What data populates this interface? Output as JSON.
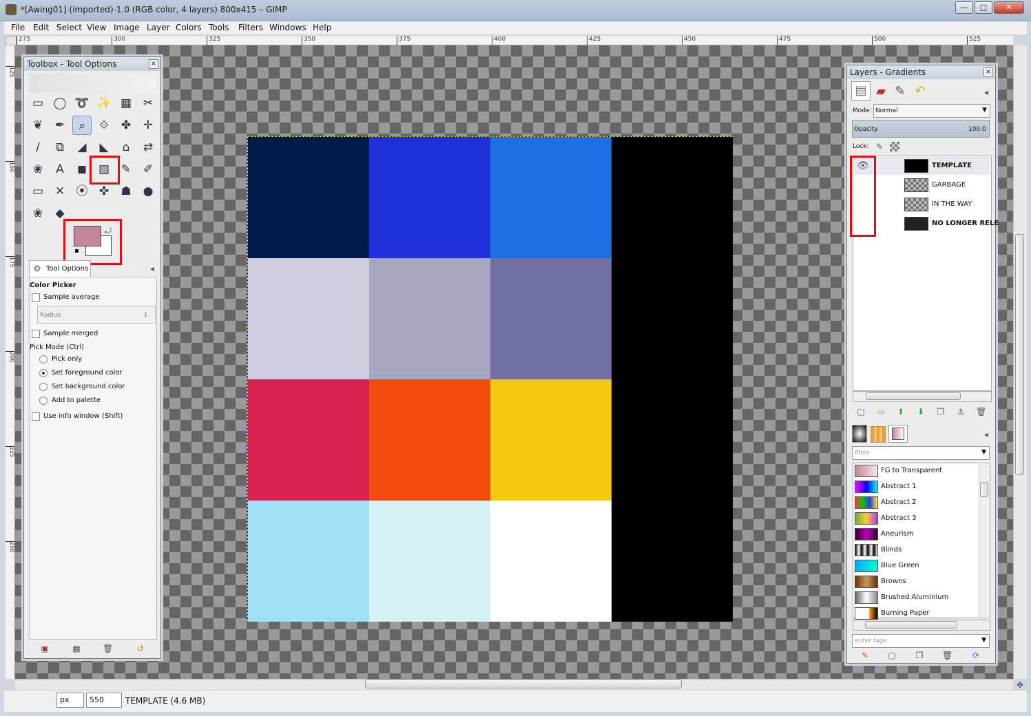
{
  "window": {
    "title": "*[Awing01] (imported)-1.0 (RGB color, 4 layers) 800x415 – GIMP",
    "minimize": "—",
    "maximize": "□",
    "close": "✕"
  },
  "menu": [
    "File",
    "Edit",
    "Select",
    "View",
    "Image",
    "Layer",
    "Colors",
    "Tools",
    "Filters",
    "Windows",
    "Help"
  ],
  "ruler": {
    "h": [
      "275",
      "300",
      "325",
      "350",
      "375",
      "400",
      "425",
      "450",
      "475",
      "500",
      "525"
    ],
    "v": [
      "125",
      "150",
      "175",
      "200",
      "225",
      "250"
    ]
  },
  "canvas": {
    "colors": [
      "#001d4a",
      "#1f31d8",
      "#1f6ee4",
      "#cfcde0",
      "#a8a7c2",
      "#7171a3",
      "#d8234e",
      "#f24b0d",
      "#f4c70e",
      "#9ee1f7",
      "#d5f1f5",
      "#ffffff"
    ]
  },
  "toolbox": {
    "title": "Toolbox - Tool Options",
    "close": "×",
    "tab_label": "Tool Options",
    "fg_color": "#c4869d",
    "bg_color": "#ffffff",
    "tools": [
      "▭",
      "◯",
      "➰",
      "✨",
      "▦",
      "✂",
      "❦",
      "✒",
      "⌕",
      "⟐",
      "✤",
      "✛",
      "∕",
      "⧉",
      "◢",
      "◣",
      "⌂",
      "⇄",
      "❀",
      "A",
      "◼",
      "▨",
      "✎",
      "✐",
      "▭",
      "✕",
      "⦿",
      "✜",
      "☗",
      "●",
      "❀",
      "◆"
    ],
    "options": {
      "heading": "Color Picker",
      "sample_average": "Sample average",
      "radius_label": "Radius",
      "radius_value": "3",
      "sample_merged": "Sample merged",
      "pick_mode": "Pick Mode  (Ctrl)",
      "modes": [
        "Pick only",
        "Set foreground color",
        "Set background color",
        "Add to palette"
      ],
      "use_info": "Use info window  (Shift)"
    }
  },
  "layers_panel": {
    "title": "Layers - Gradients",
    "close": "×",
    "mode_label": "Mode:",
    "mode_value": "Normal",
    "opacity_label": "Opacity",
    "opacity_value": "100.0",
    "lock_label": "Lock:",
    "layers": [
      {
        "name": "TEMPLATE",
        "bold": true,
        "visible": true
      },
      {
        "name": "GARBAGE",
        "bold": false,
        "visible": false
      },
      {
        "name": "IN THE WAY",
        "bold": false,
        "visible": false
      },
      {
        "name": "NO LONGER RELE",
        "bold": true,
        "visible": false
      }
    ],
    "filter_placeholder": "filter",
    "tags_placeholder": "enter tags",
    "gradients": [
      "FG to Transparent",
      "Abstract 1",
      "Abstract 2",
      "Abstract 3",
      "Aneurism",
      "Blinds",
      "Blue Green",
      "Browns",
      "Brushed Aluminium",
      "Burning Paper"
    ]
  },
  "status": {
    "unit": "px",
    "zoom": "550",
    "info": "TEMPLATE (4.6 MB)"
  }
}
